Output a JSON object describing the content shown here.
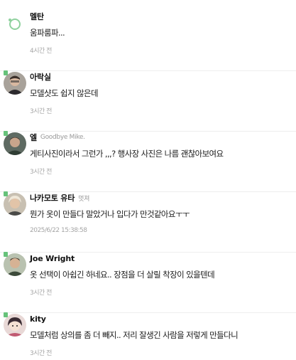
{
  "colors": {
    "level_badge": "#66c27a",
    "nickname": "#111111",
    "subtitle": "#999999",
    "text": "#1b1b1b",
    "time": "#a6a6a6",
    "divider": "#eeeeee"
  },
  "comments": [
    {
      "nickname": "멜탄",
      "subtitle": "",
      "text": "움파룸파...",
      "time": "4시간 전",
      "avatar": "green-circle-logo-icon",
      "level_badge": false
    },
    {
      "nickname": "아락실",
      "subtitle": "",
      "text": "모델샷도 쉽지 않은데",
      "time": "3시간 전",
      "avatar": "person-photo-icon",
      "level_badge": true
    },
    {
      "nickname": "엘",
      "subtitle": "Goodbye Mike.",
      "text": "게티사진이라서 그런가 ,,,? 행사장 사진은 나름 괜찮아보여요",
      "time": "3시간 전",
      "avatar": "person-photo-icon",
      "level_badge": true
    },
    {
      "nickname": "나카모토 유타",
      "subtitle": "멋져",
      "text": "뭔가 옷이 만들다 말았거나 입다가 만것같아요ㅜㅜ",
      "time": "2025/6/22 15:38:58",
      "avatar": "person-photo-icon",
      "level_badge": true
    },
    {
      "nickname": "Joe Wright",
      "subtitle": "",
      "text": "옷 선택이 아쉽긴 하네요.. 장점을 더 살릴 착장이 있을텐데",
      "time": "3시간 전",
      "avatar": "person-photo-icon",
      "level_badge": true
    },
    {
      "nickname": "kity",
      "subtitle": "",
      "text": "모델처럼 상의를 좀 더 빼지.. 저리 잘생긴 사람을 저렇게 만들다니",
      "time": "3시간 전",
      "avatar": "cartoon-avatar-icon",
      "level_badge": true
    }
  ]
}
